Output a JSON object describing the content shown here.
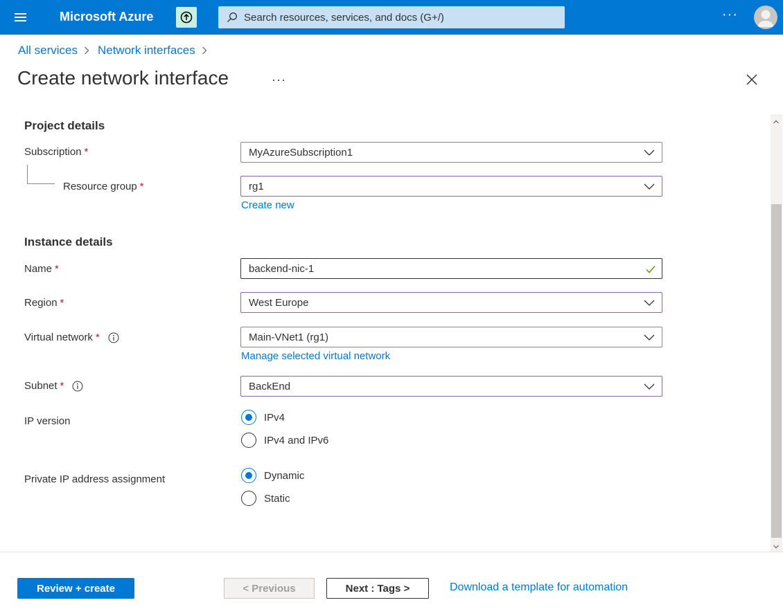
{
  "topbar": {
    "brand": "Microsoft Azure",
    "search_placeholder": "Search resources, services, and docs (G+/)",
    "more": "···"
  },
  "breadcrumb": {
    "items": [
      "All services",
      "Network interfaces"
    ]
  },
  "page": {
    "title": "Create network interface",
    "more": "···"
  },
  "project_details": {
    "heading": "Project details",
    "subscription_label": "Subscription",
    "subscription_value": "MyAzureSubscription1",
    "resource_group_label": "Resource group",
    "resource_group_value": "rg1",
    "create_new": "Create new"
  },
  "instance_details": {
    "heading": "Instance details",
    "name_label": "Name",
    "name_value": "backend-nic-1",
    "region_label": "Region",
    "region_value": "West Europe",
    "vnet_label": "Virtual network",
    "vnet_value": "Main-VNet1 (rg1)",
    "manage_vnet": "Manage selected virtual network",
    "subnet_label": "Subnet",
    "subnet_value": "BackEnd",
    "ip_version_label": "IP version",
    "ip_version_options": [
      "IPv4",
      "IPv4 and IPv6"
    ],
    "ip_version_selected": "IPv4",
    "private_ip_label": "Private IP address assignment",
    "private_ip_options": [
      "Dynamic",
      "Static"
    ],
    "private_ip_selected": "Dynamic",
    "required_marker": "*"
  },
  "footer": {
    "review_create": "Review + create",
    "previous": "< Previous",
    "next": "Next : Tags >",
    "download_template": "Download a template for automation"
  },
  "colors": {
    "accent": "#0078d4",
    "required": "#a4262c",
    "focus_border": "#8764b8",
    "valid_check": "#57a300"
  }
}
